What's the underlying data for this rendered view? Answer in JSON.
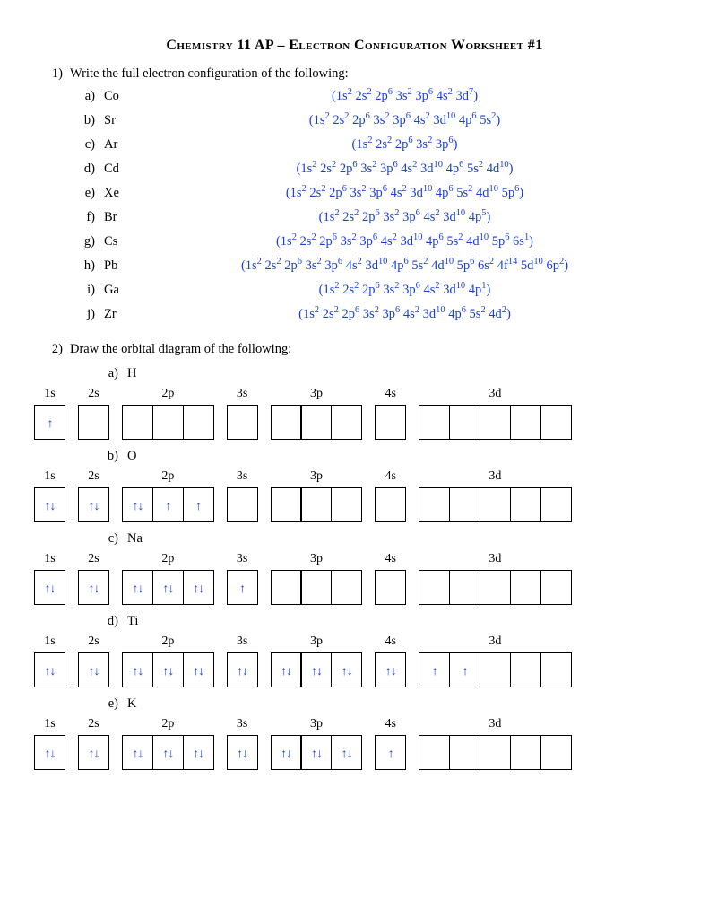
{
  "title": "Chemistry 11 AP – Electron Configuration Worksheet #1",
  "q1": {
    "num": "1)",
    "text": "Write the full electron configuration of the following:",
    "items": [
      {
        "let": "a)",
        "elem": "Co",
        "config": [
          [
            "1s",
            "2"
          ],
          [
            "2s",
            "2"
          ],
          [
            "2p",
            "6"
          ],
          [
            "3s",
            "2"
          ],
          [
            "3p",
            "6"
          ],
          [
            "4s",
            "2"
          ],
          [
            "3d",
            "7"
          ]
        ]
      },
      {
        "let": "b)",
        "elem": "Sr",
        "config": [
          [
            "1s",
            "2"
          ],
          [
            "2s",
            "2"
          ],
          [
            "2p",
            "6"
          ],
          [
            "3s",
            "2"
          ],
          [
            "3p",
            "6"
          ],
          [
            "4s",
            "2"
          ],
          [
            "3d",
            "10"
          ],
          [
            "4p",
            "6"
          ],
          [
            "5s",
            "2"
          ]
        ]
      },
      {
        "let": "c)",
        "elem": "Ar",
        "config": [
          [
            "1s",
            "2"
          ],
          [
            "2s",
            "2"
          ],
          [
            "2p",
            "6"
          ],
          [
            "3s",
            "2"
          ],
          [
            "3p",
            "6"
          ]
        ]
      },
      {
        "let": "d)",
        "elem": "Cd",
        "config": [
          [
            "1s",
            "2"
          ],
          [
            "2s",
            "2"
          ],
          [
            "2p",
            "6"
          ],
          [
            "3s",
            "2"
          ],
          [
            "3p",
            "6"
          ],
          [
            "4s",
            "2"
          ],
          [
            "3d",
            "10"
          ],
          [
            "4p",
            "6"
          ],
          [
            "5s",
            "2"
          ],
          [
            "4d",
            "10"
          ]
        ]
      },
      {
        "let": "e)",
        "elem": "Xe",
        "config": [
          [
            "1s",
            "2"
          ],
          [
            "2s",
            "2"
          ],
          [
            "2p",
            "6"
          ],
          [
            "3s",
            "2"
          ],
          [
            "3p",
            "6"
          ],
          [
            "4s",
            "2"
          ],
          [
            "3d",
            "10"
          ],
          [
            "4p",
            "6"
          ],
          [
            "5s",
            "2"
          ],
          [
            "4d",
            "10"
          ],
          [
            "5p",
            "6"
          ]
        ]
      },
      {
        "let": "f)",
        "elem": "Br",
        "config": [
          [
            "1s",
            "2"
          ],
          [
            "2s",
            "2"
          ],
          [
            "2p",
            "6"
          ],
          [
            "3s",
            "2"
          ],
          [
            "3p",
            "6"
          ],
          [
            "4s",
            "2"
          ],
          [
            "3d",
            "10"
          ],
          [
            "4p",
            "5"
          ]
        ]
      },
      {
        "let": "g)",
        "elem": "Cs",
        "config": [
          [
            "1s",
            "2"
          ],
          [
            "2s",
            "2"
          ],
          [
            "2p",
            "6"
          ],
          [
            "3s",
            "2"
          ],
          [
            "3p",
            "6"
          ],
          [
            "4s",
            "2"
          ],
          [
            "3d",
            "10"
          ],
          [
            "4p",
            "6"
          ],
          [
            "5s",
            "2"
          ],
          [
            "4d",
            "10"
          ],
          [
            "5p",
            "6"
          ],
          [
            "6s",
            "1"
          ]
        ]
      },
      {
        "let": "h)",
        "elem": "Pb",
        "config": [
          [
            "1s",
            "2"
          ],
          [
            "2s",
            "2"
          ],
          [
            "2p",
            "6"
          ],
          [
            "3s",
            "2"
          ],
          [
            "3p",
            "6"
          ],
          [
            "4s",
            "2"
          ],
          [
            "3d",
            "10"
          ],
          [
            "4p",
            "6"
          ],
          [
            "5s",
            "2"
          ],
          [
            "4d",
            "10"
          ],
          [
            "5p",
            "6"
          ],
          [
            "6s",
            "2"
          ],
          [
            "4f",
            "14"
          ],
          [
            "5d",
            "10"
          ],
          [
            "6p",
            "2"
          ]
        ]
      },
      {
        "let": "i)",
        "elem": "Ga",
        "config": [
          [
            "1s",
            "2"
          ],
          [
            "2s",
            "2"
          ],
          [
            "2p",
            "6"
          ],
          [
            "3s",
            "2"
          ],
          [
            "3p",
            "6"
          ],
          [
            "4s",
            "2"
          ],
          [
            "3d",
            "10"
          ],
          [
            "4p",
            "1"
          ]
        ]
      },
      {
        "let": "j)",
        "elem": "Zr",
        "config": [
          [
            "1s",
            "2"
          ],
          [
            "2s",
            "2"
          ],
          [
            "2p",
            "6"
          ],
          [
            "3s",
            "2"
          ],
          [
            "3p",
            "6"
          ],
          [
            "4s",
            "2"
          ],
          [
            "3d",
            "10"
          ],
          [
            "4p",
            "6"
          ],
          [
            "5s",
            "2"
          ],
          [
            "4d",
            "2"
          ]
        ]
      }
    ]
  },
  "q2": {
    "num": "2)",
    "text": "Draw the orbital diagram of the following:",
    "orbitals": [
      {
        "label": "1s",
        "n": 1
      },
      {
        "label": "2s",
        "n": 1
      },
      {
        "label": "2p",
        "n": 3
      },
      {
        "label": "3s",
        "n": 1
      },
      {
        "label": "3p",
        "n": 3
      },
      {
        "label": "4s",
        "n": 1
      },
      {
        "label": "3d",
        "n": 5
      }
    ],
    "items": [
      {
        "let": "a)",
        "elem": "H",
        "fill": [
          "u",
          "",
          "",
          "",
          "",
          "",
          "",
          "",
          "",
          "",
          "",
          "",
          "",
          "",
          ""
        ]
      },
      {
        "let": "b)",
        "elem": "O",
        "fill": [
          "ud",
          "ud",
          "ud",
          "u",
          "u",
          "",
          "",
          "",
          "",
          "",
          "",
          "",
          "",
          "",
          ""
        ]
      },
      {
        "let": "c)",
        "elem": "Na",
        "fill": [
          "ud",
          "ud",
          "ud",
          "ud",
          "ud",
          "u",
          "",
          "",
          "",
          "",
          "",
          "",
          "",
          "",
          ""
        ]
      },
      {
        "let": "d)",
        "elem": "Ti",
        "fill": [
          "ud",
          "ud",
          "ud",
          "ud",
          "ud",
          "ud",
          "ud",
          "ud",
          "ud",
          "ud",
          "u",
          "u",
          "",
          "",
          ""
        ]
      },
      {
        "let": "e)",
        "elem": "K",
        "fill": [
          "ud",
          "ud",
          "ud",
          "ud",
          "ud",
          "ud",
          "ud",
          "ud",
          "ud",
          "u",
          "",
          "",
          "",
          "",
          ""
        ]
      }
    ]
  },
  "arrows": {
    "u": "↑",
    "d": "↓",
    "ud": "↑↓"
  }
}
